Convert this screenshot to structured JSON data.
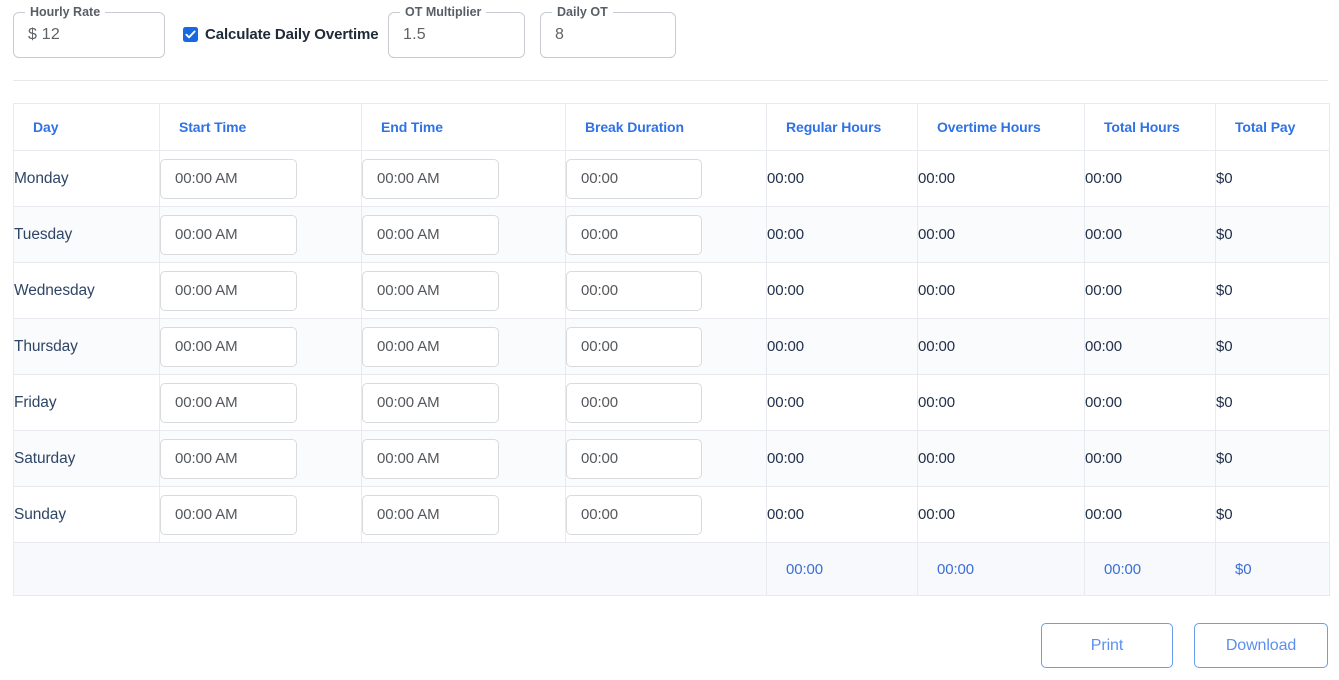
{
  "settings": {
    "hourly_rate": {
      "label": "Hourly Rate",
      "value": "$ 12"
    },
    "overtime_checkbox": {
      "label": "Calculate Daily Overtime",
      "checked": true,
      "icon": "check-icon",
      "color": "#1668e3"
    },
    "ot_multiplier": {
      "label": "OT Multiplier",
      "value": "1.5"
    },
    "daily_ot": {
      "label": "Daily OT",
      "value": "8"
    }
  },
  "table": {
    "headers": [
      "Day",
      "Start Time",
      "End Time",
      "Break Duration",
      "Regular Hours",
      "Overtime Hours",
      "Total Hours",
      "Total Pay"
    ],
    "rows": [
      {
        "day": "Monday",
        "start_time": "00:00 AM",
        "end_time": "00:00 AM",
        "break_duration": "00:00",
        "regular_hours": "00:00",
        "overtime_hours": "00:00",
        "total_hours": "00:00",
        "total_pay": "$0"
      },
      {
        "day": "Tuesday",
        "start_time": "00:00 AM",
        "end_time": "00:00 AM",
        "break_duration": "00:00",
        "regular_hours": "00:00",
        "overtime_hours": "00:00",
        "total_hours": "00:00",
        "total_pay": "$0"
      },
      {
        "day": "Wednesday",
        "start_time": "00:00 AM",
        "end_time": "00:00 AM",
        "break_duration": "00:00",
        "regular_hours": "00:00",
        "overtime_hours": "00:00",
        "total_hours": "00:00",
        "total_pay": "$0"
      },
      {
        "day": "Thursday",
        "start_time": "00:00 AM",
        "end_time": "00:00 AM",
        "break_duration": "00:00",
        "regular_hours": "00:00",
        "overtime_hours": "00:00",
        "total_hours": "00:00",
        "total_pay": "$0"
      },
      {
        "day": "Friday",
        "start_time": "00:00 AM",
        "end_time": "00:00 AM",
        "break_duration": "00:00",
        "regular_hours": "00:00",
        "overtime_hours": "00:00",
        "total_hours": "00:00",
        "total_pay": "$0"
      },
      {
        "day": "Saturday",
        "start_time": "00:00 AM",
        "end_time": "00:00 AM",
        "break_duration": "00:00",
        "regular_hours": "00:00",
        "overtime_hours": "00:00",
        "total_hours": "00:00",
        "total_pay": "$0"
      },
      {
        "day": "Sunday",
        "start_time": "00:00 AM",
        "end_time": "00:00 AM",
        "break_duration": "00:00",
        "regular_hours": "00:00",
        "overtime_hours": "00:00",
        "total_hours": "00:00",
        "total_pay": "$0"
      }
    ],
    "summary": {
      "regular_hours": "00:00",
      "overtime_hours": "00:00",
      "total_hours": "00:00",
      "total_pay": "$0"
    }
  },
  "footer": {
    "print_label": "Print",
    "download_label": "Download"
  },
  "colors": {
    "header_blue": "#2f72e6",
    "summary_blue": "#3b6fd4",
    "button_blue": "#5b90ee",
    "checkbox_blue": "#1668e3"
  }
}
